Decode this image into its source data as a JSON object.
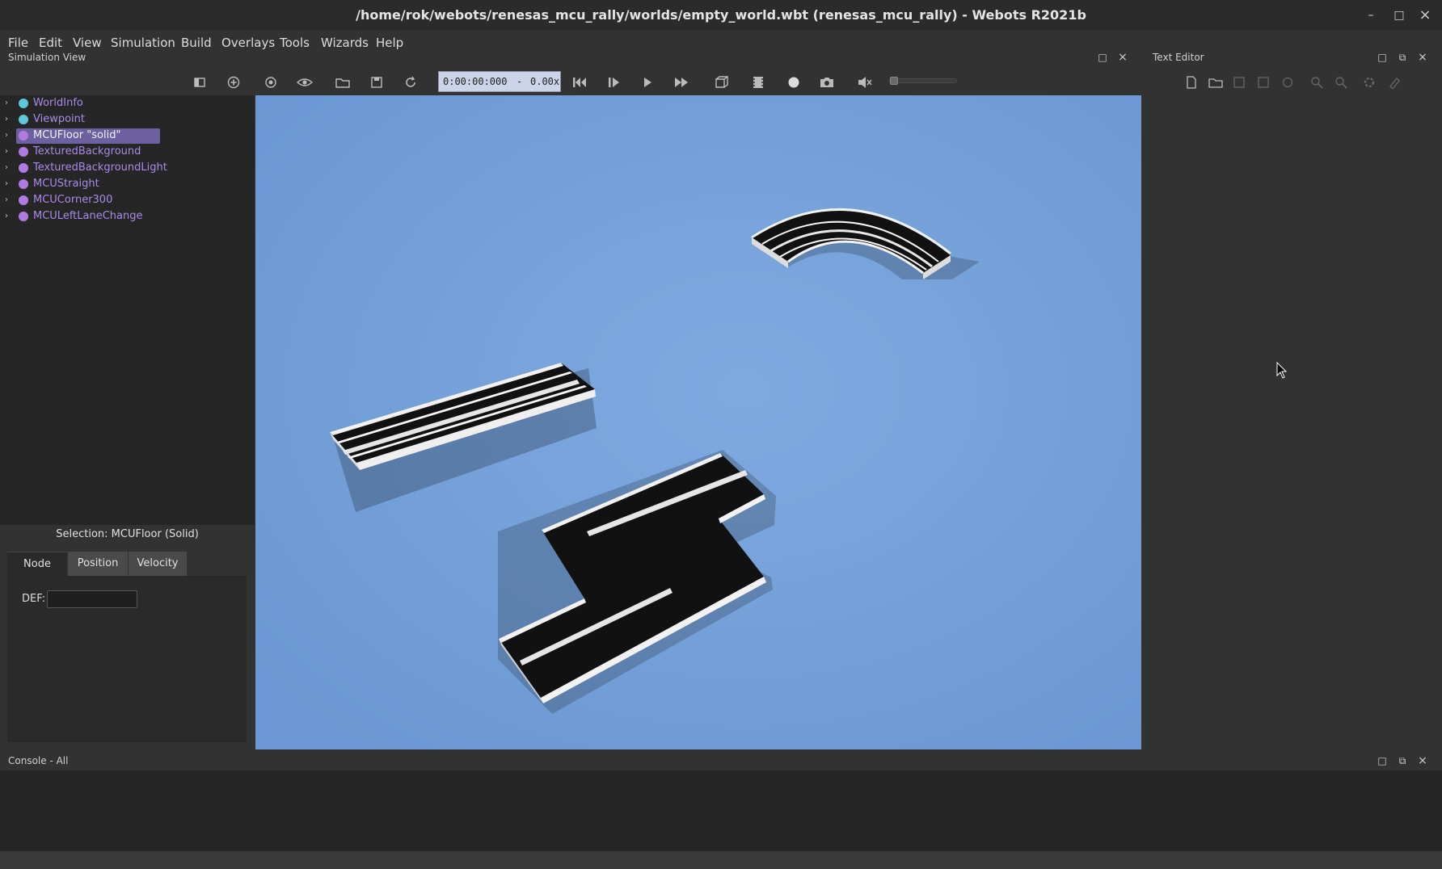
{
  "window": {
    "title": "/home/rok/webots/renesas_mcu_rally/worlds/empty_world.wbt (renesas_mcu_rally) - Webots R2021b",
    "minimize": "–",
    "maximize": "□",
    "close": "×"
  },
  "menu": [
    "File",
    "Edit",
    "View",
    "Simulation",
    "Build",
    "Overlays",
    "Tools",
    "Wizards",
    "Help"
  ],
  "simulation_view": {
    "title": "Simulation View",
    "time": "0:00:00:000",
    "separator": "-",
    "speed": "0.00x",
    "icons": [
      "hide-scene-tree-icon",
      "add-node-icon",
      "reset-viewpoint-icon",
      "view-menu-icon",
      "open-world-icon",
      "save-world-icon",
      "reload-world-icon",
      "reset-simulation-icon",
      "step-icon",
      "run-realtime-icon",
      "fast-forward-icon",
      "render-toggle-icon",
      "record-movie-icon",
      "record-icon",
      "screenshot-icon",
      "mute-icon",
      "volume-slider"
    ]
  },
  "scene_tree": {
    "items": [
      {
        "label": "WorldInfo",
        "dot": "#5fc8d8",
        "selected": false
      },
      {
        "label": "Viewpoint",
        "dot": "#5fc8d8",
        "selected": false
      },
      {
        "label": "MCUFloor \"solid\"",
        "dot": "#b07be0",
        "selected": true
      },
      {
        "label": "TexturedBackground",
        "dot": "#b07be0",
        "selected": false
      },
      {
        "label": "TexturedBackgroundLight",
        "dot": "#b07be0",
        "selected": false
      },
      {
        "label": "MCUStraight",
        "dot": "#b07be0",
        "selected": false
      },
      {
        "label": "MCUCorner300",
        "dot": "#b07be0",
        "selected": false
      },
      {
        "label": "MCULeftLaneChange",
        "dot": "#b07be0",
        "selected": false
      }
    ]
  },
  "field_editor": {
    "selection": "Selection: MCUFloor (Solid)",
    "tabs": [
      "Node",
      "Position",
      "Velocity"
    ],
    "active_tab": "Node",
    "def_label": "DEF:",
    "def_value": ""
  },
  "text_editor": {
    "title": "Text Editor",
    "icons": [
      "new-file-icon",
      "open-file-icon",
      "save-file-icon",
      "save-as-icon",
      "revert-icon",
      "find-icon",
      "replace-icon",
      "build-icon",
      "clean-icon"
    ]
  },
  "console": {
    "title": "Console - All"
  },
  "colors": {
    "viewport_bg": "#73a0d8",
    "selection": "#6c60a0",
    "node_label": "#a98ae8"
  }
}
